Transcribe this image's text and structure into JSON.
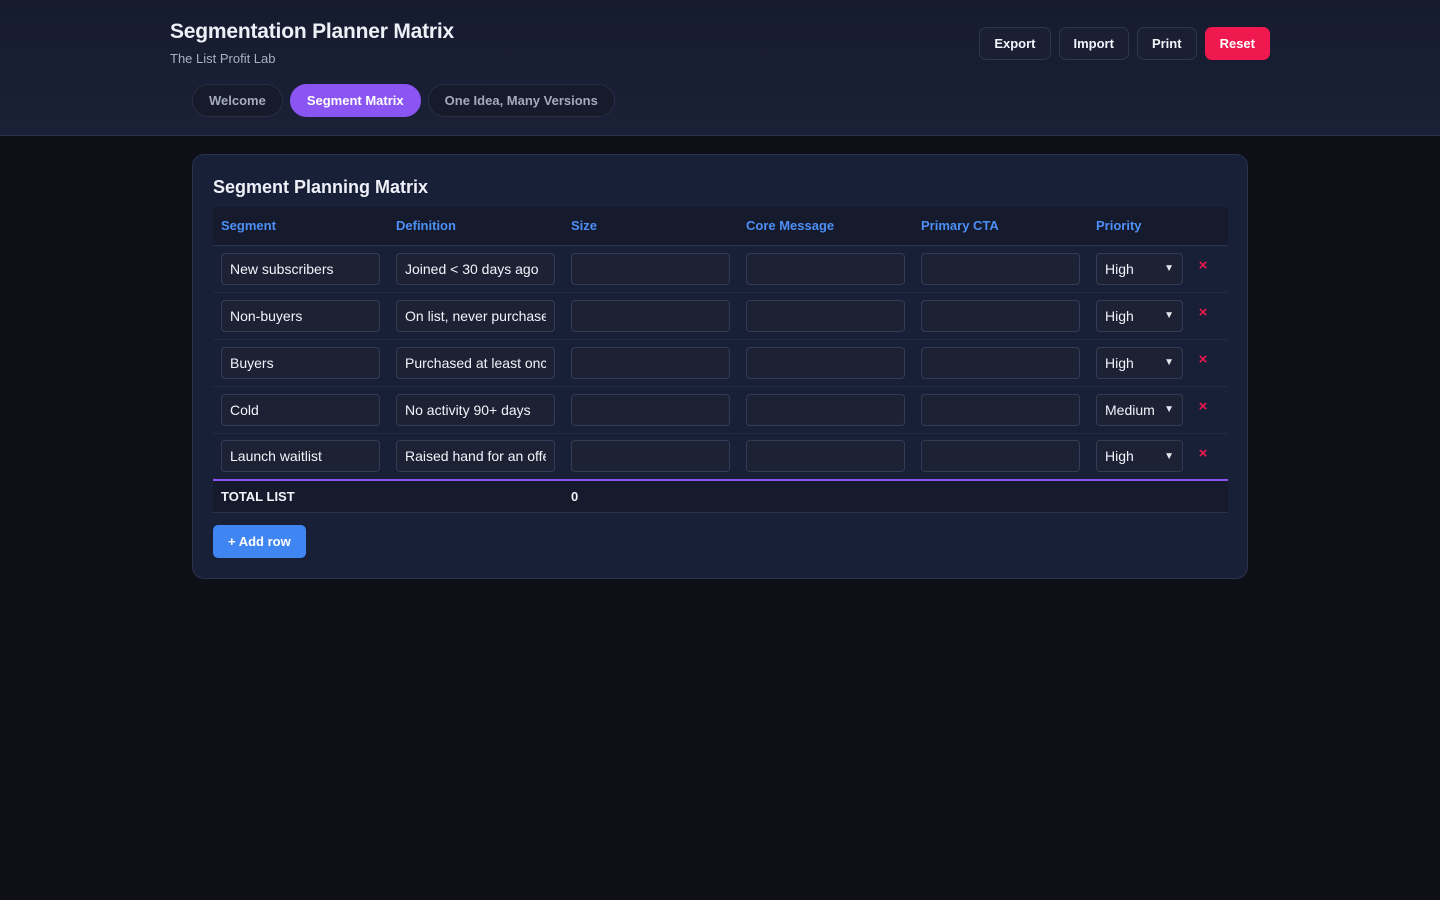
{
  "header": {
    "title": "Segmentation Planner Matrix",
    "subtitle": "The List Profit Lab",
    "actions": {
      "export": "Export",
      "import": "Import",
      "print": "Print",
      "reset": "Reset"
    }
  },
  "tabs": [
    {
      "label": "Welcome"
    },
    {
      "label": "Segment Matrix",
      "active": true
    },
    {
      "label": "One Idea, Many Versions"
    }
  ],
  "matrix": {
    "title": "Segment Planning Matrix",
    "columns": [
      "Segment",
      "Definition",
      "Size",
      "Core Message",
      "Primary CTA",
      "Priority"
    ],
    "rows": [
      {
        "segment": "New subscribers",
        "definition": "Joined < 30 days ago",
        "size": "",
        "message": "",
        "cta": "",
        "priority": "High"
      },
      {
        "segment": "Non-buyers",
        "definition": "On list, never purchased",
        "size": "",
        "message": "",
        "cta": "",
        "priority": "High"
      },
      {
        "segment": "Buyers",
        "definition": "Purchased at least once",
        "size": "",
        "message": "",
        "cta": "",
        "priority": "High"
      },
      {
        "segment": "Cold",
        "definition": "No activity 90+ days",
        "size": "",
        "message": "",
        "cta": "",
        "priority": "Medium"
      },
      {
        "segment": "Launch waitlist",
        "definition": "Raised hand for an offer",
        "size": "",
        "message": "",
        "cta": "",
        "priority": "High"
      }
    ],
    "total_label": "TOTAL LIST",
    "total_value": "0",
    "delete_glyph": "×",
    "add_row_label": "+ Add row"
  },
  "colors": {
    "accent_purple": "#8b55f3",
    "accent_blue": "#3f86f2",
    "danger": "#f0194f",
    "background": "#0f0f17"
  }
}
